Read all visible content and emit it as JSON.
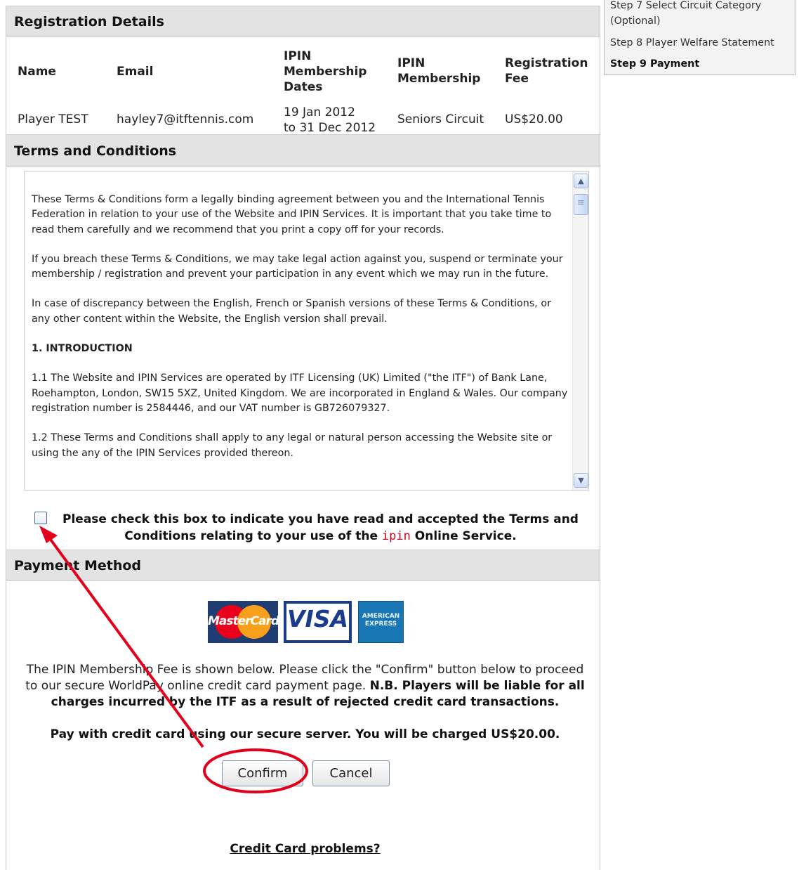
{
  "registration": {
    "header": "Registration Details",
    "columns": [
      "Name",
      "Email",
      "IPIN Membership Dates",
      "IPIN Membership",
      "Registration Fee"
    ],
    "row": {
      "name": "Player TEST",
      "email": "hayley7@itftennis.com",
      "dates_line1": "19 Jan 2012",
      "dates_line2": "to 31 Dec 2012",
      "membership": "Seniors Circuit",
      "fee": "US$20.00"
    }
  },
  "terms": {
    "header": "Terms and Conditions",
    "paragraphs": [
      "These Terms & Conditions form a legally binding agreement between you and the International Tennis Federation in relation to your use of the Website and IPIN Services. It is important that you take time to read them carefully and we recommend that you print a copy off for your records.",
      "If you breach these Terms & Conditions, we may take legal action against you, suspend or terminate your membership / registration and prevent your participation in any event which we may run in the future.",
      "In case of discrepancy between the English, French or Spanish versions of these Terms & Conditions, or any other content within the Website, the English version shall prevail.",
      "1. INTRODUCTION",
      "1.1 The Website and IPIN Services are operated by ITF Licensing (UK) Limited (\"the ITF\") of Bank Lane, Roehampton, London, SW15 5XZ, United Kingdom. We are incorporated in England & Wales. Our company registration number is 2584446, and our VAT number is GB726079327.",
      "1.2 These Terms and Conditions shall apply to any legal or natural person accessing the Website site or using the any of the IPIN Services provided thereon."
    ],
    "accept_text_1": "Please check this box to indicate you have read and accepted the Terms and Conditions relating to your use of the ",
    "accept_ipin": "ipin",
    "accept_text_2": " Online Service."
  },
  "payment": {
    "header": "Payment Method",
    "cards": [
      "MasterCard",
      "VISA",
      "AMERICAN EXPRESS"
    ],
    "info": "The IPIN Membership Fee is shown below. Please click the \"Confirm\" button below to proceed to our secure WorldPay online credit card payment page.",
    "info_bold": "N.B. Players will be liable for all charges incurred by the ITF as a result of rejected credit card transactions.",
    "charge": "Pay with credit card using our secure server. You will be charged US$20.00.",
    "confirm_label": "Confirm",
    "cancel_label": "Cancel",
    "cc_problems": "Credit Card problems?"
  },
  "steps": {
    "step7_line1": "Step 7 Select Circuit Category",
    "step7_line2": "(Optional)",
    "step8": "Step 8 Player Welfare Statement",
    "step9": "Step 9 Payment"
  },
  "annotation_colors": {
    "red": "#e3001b"
  }
}
